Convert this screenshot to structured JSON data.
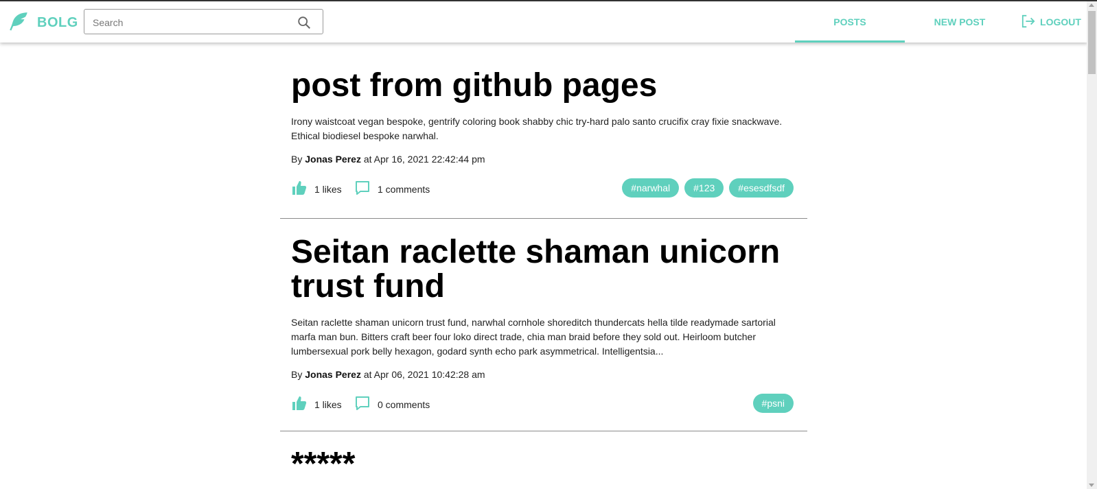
{
  "header": {
    "brand": "BOLG",
    "search_placeholder": "Search",
    "nav": {
      "posts": "POSTS",
      "new_post": "NEW POST",
      "logout": "LOGOUT"
    }
  },
  "posts": [
    {
      "title": "post from github pages",
      "excerpt": "Irony waistcoat vegan bespoke, gentrify coloring book shabby chic try-hard palo santo crucifix cray fixie snackwave. Ethical biodiesel bespoke narwhal.",
      "by": "By",
      "author": "Jonas Perez",
      "at": "at Apr 16, 2021 22:42:44 pm",
      "likes": "1 likes",
      "comments": "1 comments",
      "tags": [
        "#narwhal",
        "#123",
        "#esesdfsdf"
      ]
    },
    {
      "title": "Seitan raclette shaman unicorn trust fund",
      "excerpt": "Seitan raclette shaman unicorn trust fund, narwhal cornhole shoreditch thundercats hella tilde readymade sartorial marfa man bun. Bitters craft beer four loko direct trade, chia man braid before they sold out. Heirloom butcher lumbersexual pork belly hexagon, godard synth echo park asymmetrical. Intelligentsia...",
      "by": "By",
      "author": "Jonas Perez",
      "at": "at Apr 06, 2021 10:42:28 am",
      "likes": "1 likes",
      "comments": "0 comments",
      "tags": [
        "#psni"
      ]
    },
    {
      "title": "*****"
    }
  ],
  "colors": {
    "accent": "#5fd0bd",
    "divider": "#8a8a8a"
  },
  "icons": {
    "brand": "feather-icon",
    "search": "search-icon",
    "logout": "logout-icon",
    "like": "thumbs-up-icon",
    "comment": "comment-icon"
  }
}
